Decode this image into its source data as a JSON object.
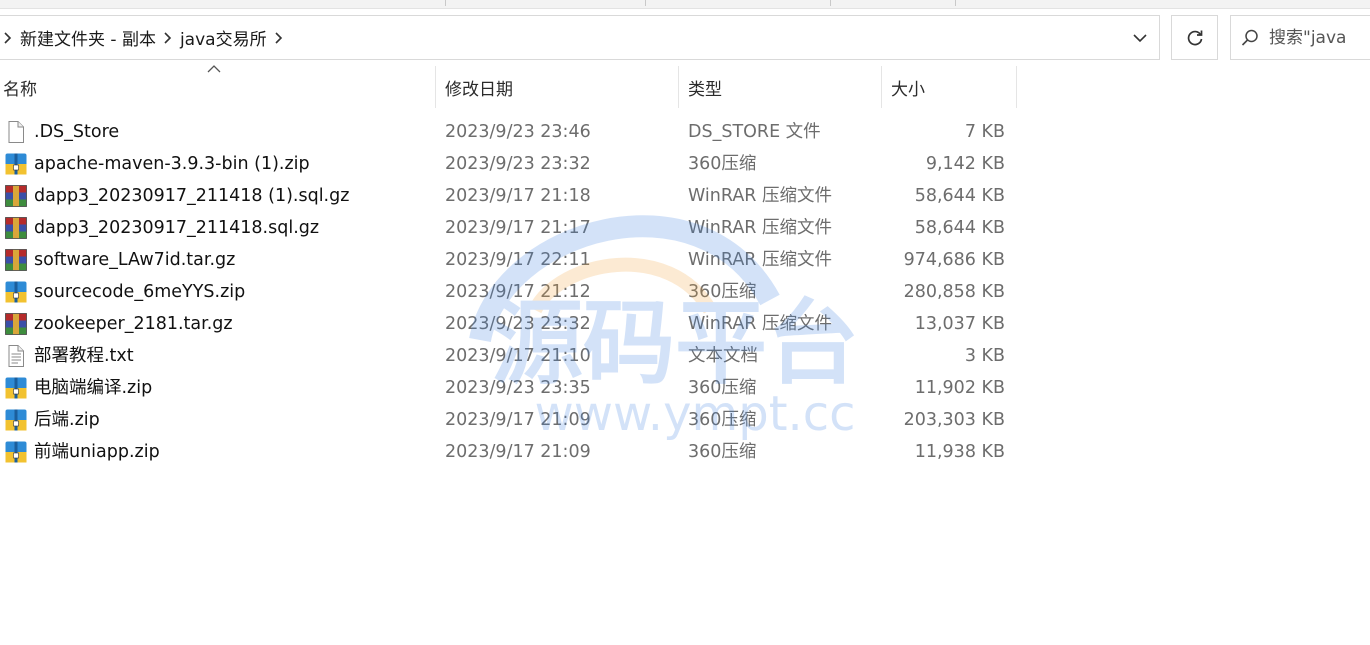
{
  "colors": {
    "zip_icon_blue": "#2e8bd6",
    "zip_icon_yellow": "#f2c230",
    "rar_icon_red": "#b52b2b",
    "rar_icon_blue": "#3a4fa8",
    "watermark_blue": "#3b7fe0",
    "watermark_orange": "#f3a33b"
  },
  "breadcrumb": {
    "items": [
      "新建文件夹 - 副本",
      "java交易所"
    ]
  },
  "search": {
    "placeholder": "搜索\"java"
  },
  "columns": {
    "name": "名称",
    "date": "修改日期",
    "type": "类型",
    "size": "大小"
  },
  "files": [
    {
      "name": ".DS_Store",
      "date": "2023/9/23 23:46",
      "type": "DS_STORE 文件",
      "size": "7 KB",
      "icon": "blank-file-icon"
    },
    {
      "name": "apache-maven-3.9.3-bin (1).zip",
      "date": "2023/9/23 23:32",
      "type": "360压缩",
      "size": "9,142 KB",
      "icon": "zip-archive-icon"
    },
    {
      "name": "dapp3_20230917_211418 (1).sql.gz",
      "date": "2023/9/17 21:18",
      "type": "WinRAR 压缩文件",
      "size": "58,644 KB",
      "icon": "winrar-archive-icon"
    },
    {
      "name": "dapp3_20230917_211418.sql.gz",
      "date": "2023/9/17 21:17",
      "type": "WinRAR 压缩文件",
      "size": "58,644 KB",
      "icon": "winrar-archive-icon"
    },
    {
      "name": "software_LAw7id.tar.gz",
      "date": "2023/9/17 22:11",
      "type": "WinRAR 压缩文件",
      "size": "974,686 KB",
      "icon": "winrar-archive-icon"
    },
    {
      "name": "sourcecode_6meYYS.zip",
      "date": "2023/9/17 21:12",
      "type": "360压缩",
      "size": "280,858 KB",
      "icon": "zip-archive-icon"
    },
    {
      "name": "zookeeper_2181.tar.gz",
      "date": "2023/9/23 23:32",
      "type": "WinRAR 压缩文件",
      "size": "13,037 KB",
      "icon": "winrar-archive-icon"
    },
    {
      "name": "部署教程.txt",
      "date": "2023/9/17 21:10",
      "type": "文本文档",
      "size": "3 KB",
      "icon": "text-file-icon"
    },
    {
      "name": "电脑端编译.zip",
      "date": "2023/9/23 23:35",
      "type": "360压缩",
      "size": "11,902 KB",
      "icon": "zip-archive-icon"
    },
    {
      "name": "后端.zip",
      "date": "2023/9/17 21:09",
      "type": "360压缩",
      "size": "203,303 KB",
      "icon": "zip-archive-icon"
    },
    {
      "name": "前端uniapp.zip",
      "date": "2023/9/17 21:09",
      "type": "360压缩",
      "size": "11,938 KB",
      "icon": "zip-archive-icon"
    }
  ],
  "watermark": {
    "title": "源码平台",
    "url": "www.ympt.cc"
  }
}
